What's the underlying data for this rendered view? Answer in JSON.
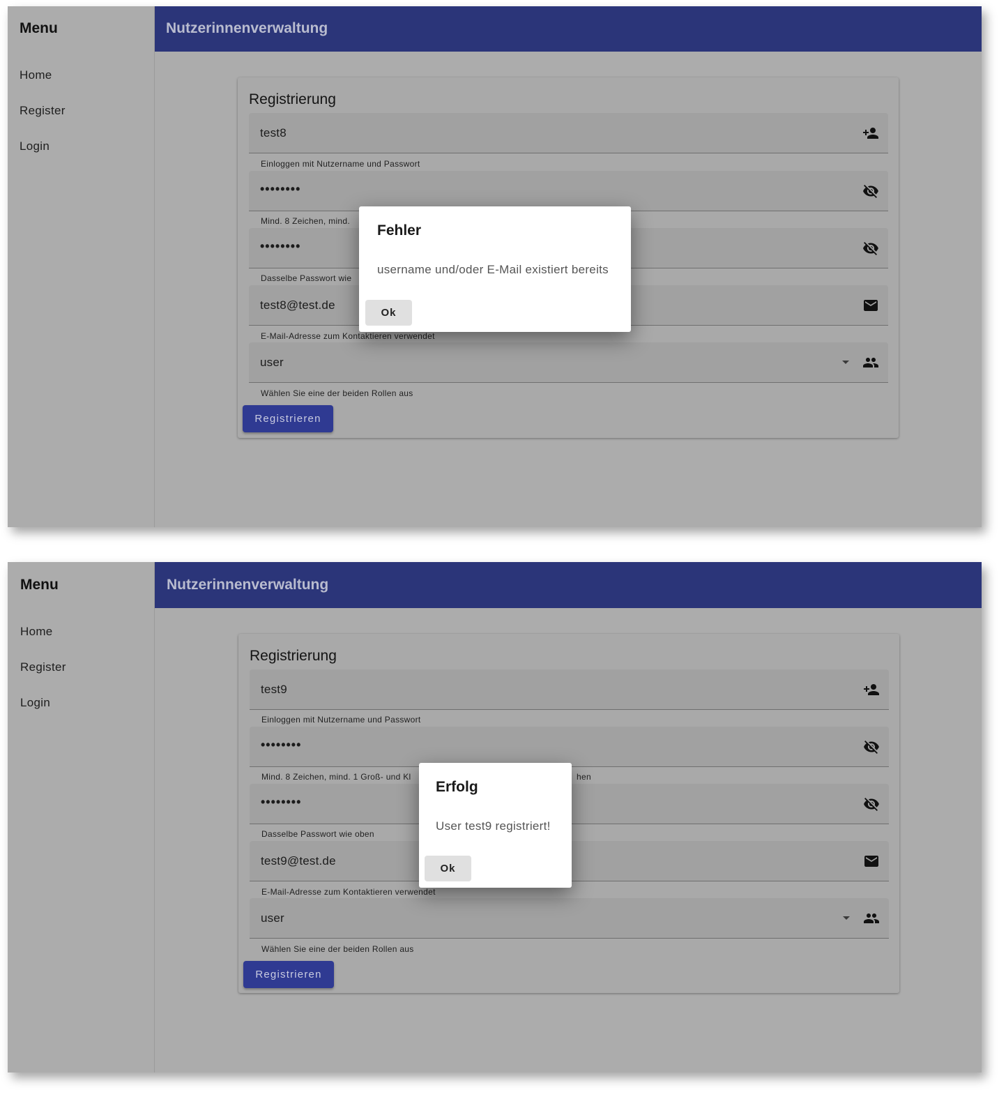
{
  "screens": [
    {
      "sidebar": {
        "title": "Menu",
        "items": [
          "Home",
          "Register",
          "Login"
        ]
      },
      "toolbar": {
        "title": "Nutzerinnenverwaltung"
      },
      "form": {
        "title": "Registrierung",
        "username": {
          "value": "test8",
          "hint": "Einloggen mit Nutzername und Passwort",
          "icon": "person-add-icon"
        },
        "password": {
          "value": "••••••••",
          "hint": "Mind. 8 Zeichen, mind.",
          "icon": "visibility-off-icon"
        },
        "password_confirm": {
          "value": "••••••••",
          "hint": "Dasselbe Passwort wie",
          "icon": "visibility-off-icon"
        },
        "email": {
          "value": "test8@test.de",
          "hint": "E-Mail-Adresse zum Kontaktieren verwendet",
          "icon": "mail-icon"
        },
        "role": {
          "value": "user",
          "hint": "Wählen Sie eine der beiden Rollen aus",
          "icon": "people-icon"
        },
        "submit": "Registrieren"
      },
      "dialog": {
        "title": "Fehler",
        "message": "username und/oder E-Mail existiert bereits",
        "ok": "Ok"
      }
    },
    {
      "sidebar": {
        "title": "Menu",
        "items": [
          "Home",
          "Register",
          "Login"
        ]
      },
      "toolbar": {
        "title": "Nutzerinnenverwaltung"
      },
      "form": {
        "title": "Registrierung",
        "username": {
          "value": "test9",
          "hint": "Einloggen mit Nutzername und Passwort",
          "icon": "person-add-icon"
        },
        "password": {
          "value": "••••••••",
          "hint": "Mind. 8 Zeichen, mind. 1 Groß- und Kl",
          "hint_tail": "hen",
          "icon": "visibility-off-icon"
        },
        "password_confirm": {
          "value": "••••••••",
          "hint": "Dasselbe Passwort wie oben",
          "icon": "visibility-off-icon"
        },
        "email": {
          "value": "test9@test.de",
          "hint": "E-Mail-Adresse zum Kontaktieren verwendet",
          "icon": "mail-icon"
        },
        "role": {
          "value": "user",
          "hint": "Wählen Sie eine der beiden Rollen aus",
          "icon": "people-icon"
        },
        "submit": "Registrieren"
      },
      "dialog": {
        "title": "Erfolg",
        "message": "User test9 registriert!",
        "ok": "Ok"
      }
    }
  ]
}
